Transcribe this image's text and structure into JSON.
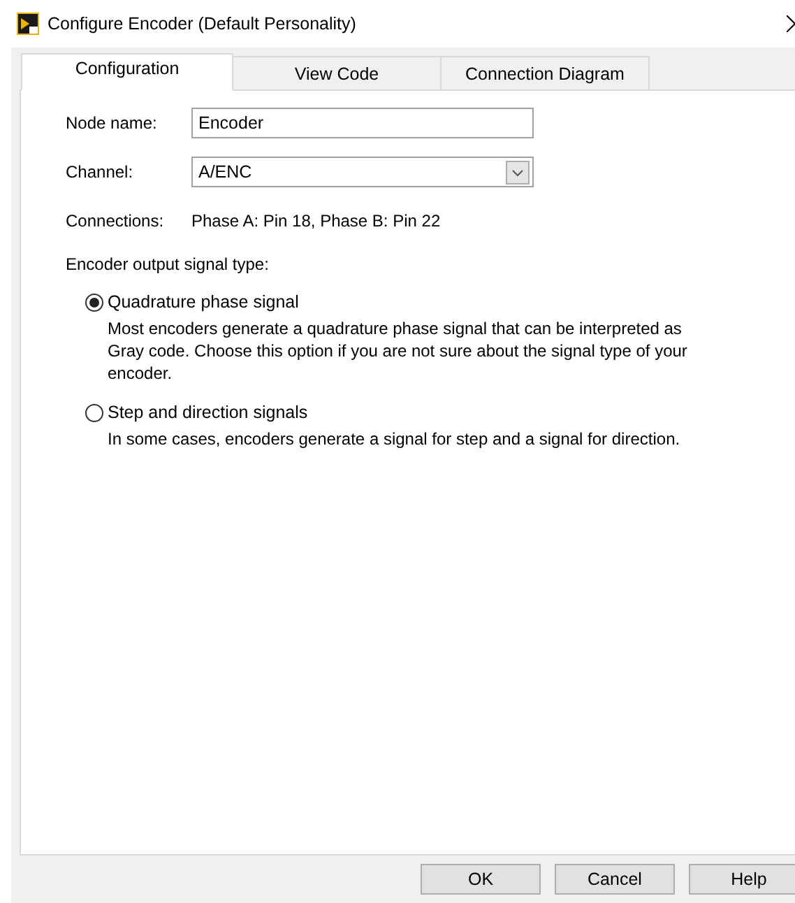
{
  "window": {
    "title": "Configure Encoder (Default Personality)"
  },
  "tabs": [
    {
      "label": "Configuration",
      "selected": true
    },
    {
      "label": "View Code",
      "selected": false
    },
    {
      "label": "Connection Diagram",
      "selected": false
    }
  ],
  "form": {
    "node_name": {
      "label": "Node name:",
      "value": "Encoder"
    },
    "channel": {
      "label": "Channel:",
      "value": "A/ENC"
    },
    "connections": {
      "label": "Connections:",
      "value": "Phase A: Pin 18, Phase B: Pin 22"
    }
  },
  "signal_type": {
    "label": "Encoder output signal type:",
    "options": [
      {
        "label": "Quadrature phase signal",
        "selected": true,
        "description": "Most encoders generate a quadrature phase signal that can be interpreted as Gray code. Choose this option if you are not sure about the signal type of your encoder."
      },
      {
        "label": "Step and direction signals",
        "selected": false,
        "description": "In some cases, encoders generate a signal for step and a signal for direction."
      }
    ]
  },
  "buttons": [
    "OK",
    "Cancel",
    "Help"
  ]
}
